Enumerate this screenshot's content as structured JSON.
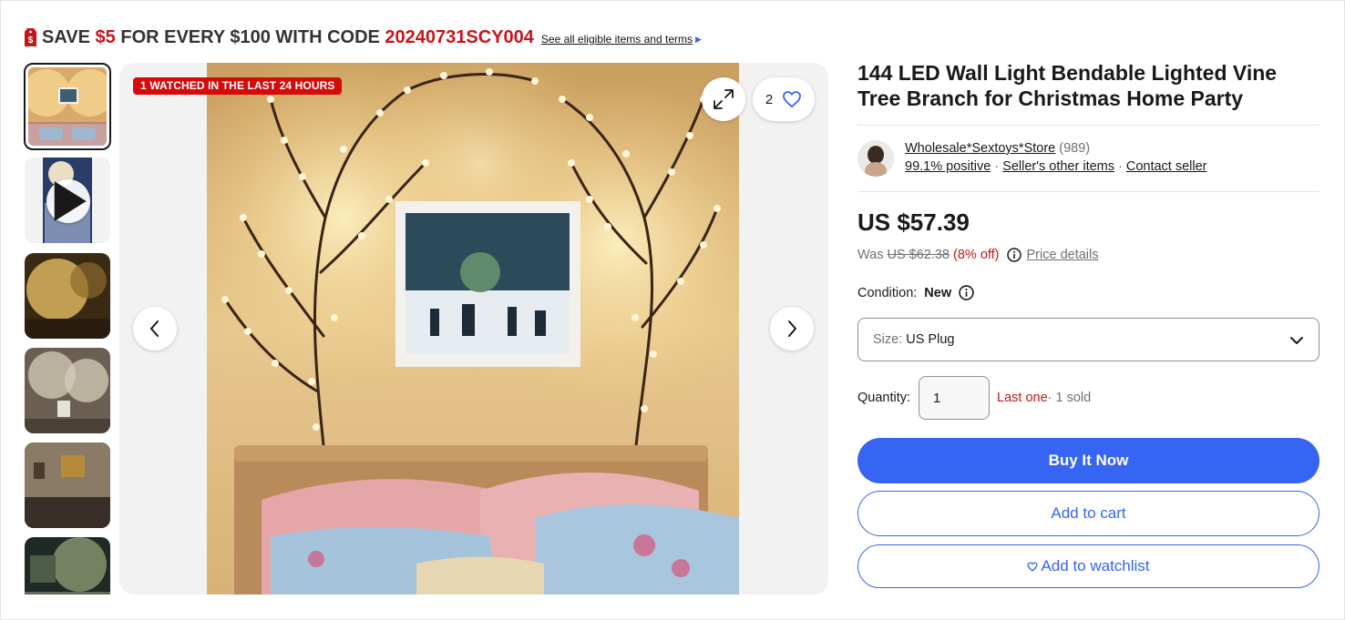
{
  "promo": {
    "tag_icon": "price-tag-icon",
    "save_prefix": "SAVE ",
    "save_amount": "$5",
    "save_middle": " FOR EVERY $100 WITH CODE ",
    "code": "20240731SCY004",
    "link": "See all eligible items and terms",
    "accent_color": "#c4161c"
  },
  "gallery": {
    "thumbnails": [
      {
        "label": "photo 1",
        "selected": true
      },
      {
        "label": "video",
        "selected": false
      },
      {
        "label": "photo 3",
        "selected": false
      },
      {
        "label": "photo 4",
        "selected": false
      },
      {
        "label": "photo 5",
        "selected": false
      },
      {
        "label": "photo 6",
        "selected": false
      }
    ],
    "watch_badge": "1 WATCHED IN THE LAST 24 HOURS",
    "watchers_count": "2"
  },
  "listing": {
    "title": "144 LED Wall Light Bendable Lighted Vine Tree Branch for Christmas Home Party",
    "seller": {
      "name": "Wholesale*Sextoys*Store",
      "feedback_count": "(989)",
      "positive": "99.1% positive",
      "other_items": "Seller's other items",
      "contact": "Contact seller"
    },
    "price": "US $57.39",
    "was_label": "Was",
    "was_price": "US $62.38",
    "discount": "(8% off)",
    "price_details": "Price details",
    "condition_label": "Condition:",
    "condition_value": "New",
    "size_label": "Size:",
    "size_value": "US Plug",
    "quantity_label": "Quantity:",
    "quantity_value": "1",
    "stock_note": "Last one",
    "sold_note": " · 1 sold",
    "buy_now": "Buy It Now",
    "add_to_cart": "Add to cart",
    "add_to_watchlist": "Add to watchlist",
    "brand_color": "#3665f3"
  }
}
